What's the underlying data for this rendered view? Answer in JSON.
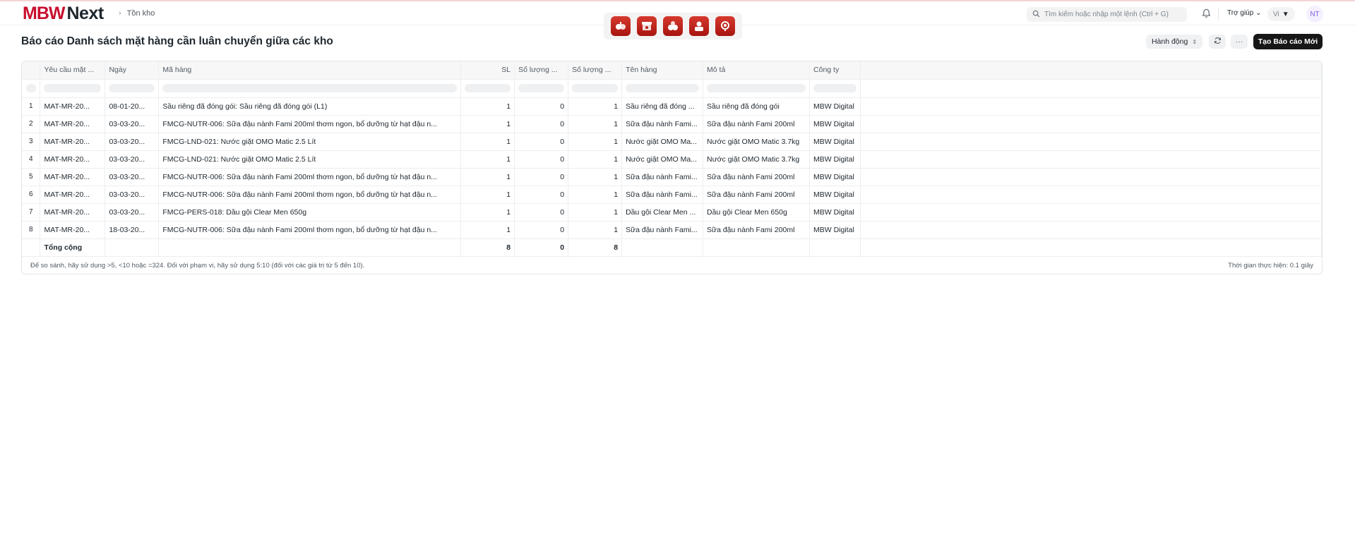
{
  "app": {
    "logo_mbw": "MBW",
    "logo_next": "Next"
  },
  "breadcrumb": {
    "item": "Tồn kho"
  },
  "app_launcher": {
    "icons": [
      "app-icon-1",
      "app-icon-2",
      "app-icon-3",
      "app-icon-4",
      "app-icon-5"
    ]
  },
  "search": {
    "placeholder": "Tìm kiếm hoặc nhập một lệnh (Ctrl + G)"
  },
  "navbar": {
    "help_label": "Trợ giúp",
    "lang_label": "Vi",
    "avatar_initials": "NT"
  },
  "page": {
    "title": "Báo cáo Danh sách mặt hàng cần luân chuyển giữa các kho"
  },
  "toolbar": {
    "actions_label": "Hành động",
    "new_report_label": "Tạo Báo cáo Mới"
  },
  "table": {
    "columns": [
      "Yêu cầu mặt ...",
      "Ngày",
      "Mã hàng",
      "SL",
      "Số lượng ...",
      "Số lượng ...",
      "Tên hàng",
      "Mô tả",
      "Công ty"
    ],
    "rows": [
      [
        "1",
        "MAT-MR-20...",
        "08-01-20...",
        "Sầu riêng đã đóng gói: Sầu riêng đã đóng gói (L1)",
        "1",
        "0",
        "1",
        "Sầu riêng đã đóng ...",
        "Sầu riêng đã đóng gói",
        "MBW Digital"
      ],
      [
        "2",
        "MAT-MR-20...",
        "03-03-20...",
        "FMCG-NUTR-006: Sữa đậu nành Fami 200ml thơm ngon, bổ dưỡng từ hạt đậu n...",
        "1",
        "0",
        "1",
        "Sữa đậu nành Fami...",
        "Sữa đậu nành Fami 200ml",
        "MBW Digital"
      ],
      [
        "3",
        "MAT-MR-20...",
        "03-03-20...",
        "FMCG-LND-021: Nước giặt OMO Matic 2.5 Lít",
        "1",
        "0",
        "1",
        "Nước giặt OMO Ma...",
        "Nước giặt OMO Matic 3.7kg",
        "MBW Digital"
      ],
      [
        "4",
        "MAT-MR-20...",
        "03-03-20...",
        "FMCG-LND-021: Nước giặt OMO Matic 2.5 Lít",
        "1",
        "0",
        "1",
        "Nước giặt OMO Ma...",
        "Nước giặt OMO Matic 3.7kg",
        "MBW Digital"
      ],
      [
        "5",
        "MAT-MR-20...",
        "03-03-20...",
        "FMCG-NUTR-006: Sữa đậu nành Fami 200ml thơm ngon, bổ dưỡng từ hạt đậu n...",
        "1",
        "0",
        "1",
        "Sữa đậu nành Fami...",
        "Sữa đậu nành Fami 200ml",
        "MBW Digital"
      ],
      [
        "6",
        "MAT-MR-20...",
        "03-03-20...",
        "FMCG-NUTR-006: Sữa đậu nành Fami 200ml thơm ngon, bổ dưỡng từ hạt đậu n...",
        "1",
        "0",
        "1",
        "Sữa đậu nành Fami...",
        "Sữa đậu nành Fami 200ml",
        "MBW Digital"
      ],
      [
        "7",
        "MAT-MR-20...",
        "03-03-20...",
        "FMCG-PERS-018: Dầu gội Clear Men 650g",
        "1",
        "0",
        "1",
        "Dầu gội Clear Men ...",
        "Dầu gội Clear Men 650g",
        "MBW Digital"
      ],
      [
        "8",
        "MAT-MR-20...",
        "18-03-20...",
        "FMCG-NUTR-006: Sữa đậu nành Fami 200ml thơm ngon, bổ dưỡng từ hạt đậu n...",
        "1",
        "0",
        "1",
        "Sữa đậu nành Fami...",
        "Sữa đậu nành Fami 200ml",
        "MBW Digital"
      ]
    ],
    "total": {
      "label": "Tổng cộng",
      "sl": "8",
      "qty1": "0",
      "qty2": "8"
    }
  },
  "footer": {
    "hint": "Để so sánh, hãy sử dụng >5, <10 hoặc =324. Đối với phạm vi, hãy sử dụng 5:10 (đối với các giá trị từ 5 đến 10).",
    "exec_time": "Thời gian thực hiện: 0.1 giây"
  },
  "colors": {
    "brand_red": "#c8102e",
    "primary_button": "#171717"
  }
}
